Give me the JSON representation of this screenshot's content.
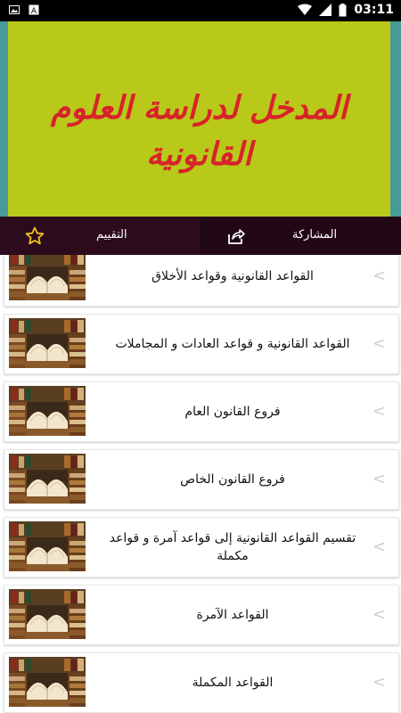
{
  "status_bar": {
    "time": "03:11",
    "left_icons": [
      "image-icon",
      "text-a-icon"
    ],
    "right_icons": [
      "wifi-icon",
      "signal-icon",
      "battery-icon"
    ]
  },
  "banner": {
    "title_line1": "المدخل لدراسة العلوم",
    "title_line2": "القانونية"
  },
  "action_bar": {
    "share_label": "المشاركة",
    "share_icon": "share-icon",
    "rate_label": "التقييم",
    "rate_icon": "star-icon"
  },
  "items": [
    {
      "title": "القواعد القانونية وقواعد الأخلاق"
    },
    {
      "title": "القواعد القانونية و قواعد العادات و المجاملات"
    },
    {
      "title": "فروع القانون العام"
    },
    {
      "title": "فروع القانون الخاص"
    },
    {
      "title": "تقسيم القواعد القانونية إلى قواعد آمرة و قواعد مكملة"
    },
    {
      "title": "القواعد الآمرة"
    },
    {
      "title": "القواعد المكملة"
    }
  ],
  "chevron_glyph": "<",
  "colors": {
    "banner_bg": "#b8c919",
    "banner_edge": "#4a9a9a",
    "title_red": "#d8232a",
    "actionbar_bg": "#2b0b1c"
  }
}
